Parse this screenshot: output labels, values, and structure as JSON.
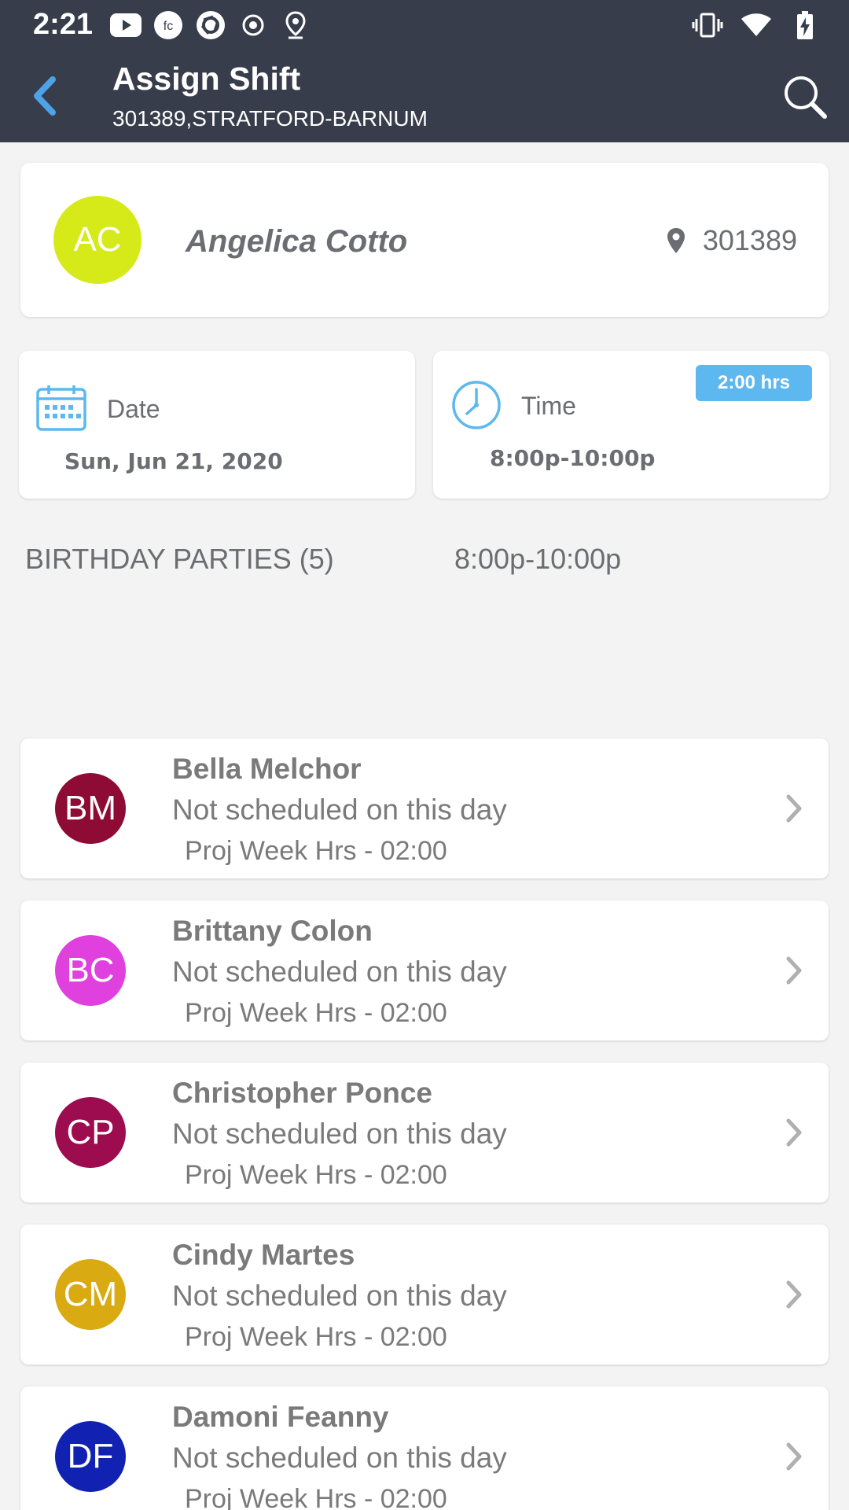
{
  "status_bar": {
    "time": "2:21",
    "left_icons": [
      "youtube-icon",
      "fc-app-icon",
      "shutter-app-icon",
      "record-icon",
      "location-pin-icon"
    ],
    "right_icons": [
      "vibrate-icon",
      "wifi-icon",
      "battery-charging-icon"
    ]
  },
  "header": {
    "title": "Assign Shift",
    "subtitle": "301389,STRATFORD-BARNUM"
  },
  "employee": {
    "initials": "AC",
    "name": "Angelica Cotto",
    "location_id": "301389",
    "avatar_color": "#d6ea1a"
  },
  "date_card": {
    "label": "Date",
    "value": "Sun, Jun 21, 2020"
  },
  "time_card": {
    "label": "Time",
    "value": "8:00p-10:00p",
    "badge": "2:00 hrs"
  },
  "section": {
    "name": "BIRTHDAY PARTIES (5)",
    "time": "8:00p-10:00p"
  },
  "colors": {
    "app_bar": "#373d4b",
    "accent_blue": "#5cb8ef",
    "back_icon": "#4da3e8"
  },
  "staff": [
    {
      "initials": "BM",
      "name": "Bella Melchor",
      "status": "Not scheduled on this day",
      "hours": "Proj Week Hrs - 02:00",
      "color": "#8e0b35"
    },
    {
      "initials": "BC",
      "name": "Brittany Colon",
      "status": "Not scheduled on this day",
      "hours": "Proj Week Hrs - 02:00",
      "color": "#e040dd"
    },
    {
      "initials": "CP",
      "name": "Christopher Ponce",
      "status": "Not scheduled on this day",
      "hours": "Proj Week Hrs - 02:00",
      "color": "#9c0c4e"
    },
    {
      "initials": "CM",
      "name": "Cindy Martes",
      "status": "Not scheduled on this day",
      "hours": "Proj Week Hrs - 02:00",
      "color": "#d9aa12"
    },
    {
      "initials": "DF",
      "name": "Damoni Feanny",
      "status": "Not scheduled on this day",
      "hours": "Proj Week Hrs - 02:00",
      "color": "#1122b3"
    }
  ]
}
